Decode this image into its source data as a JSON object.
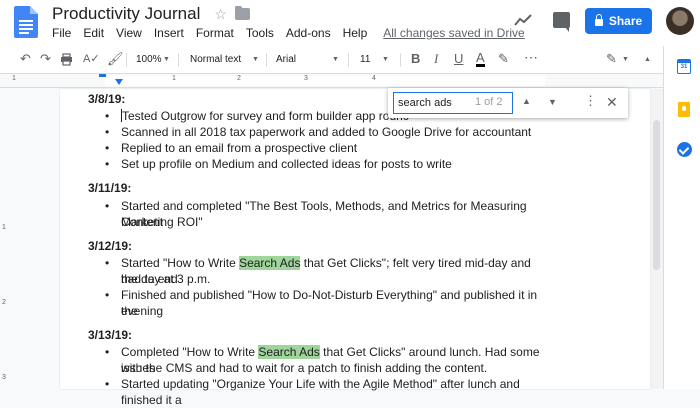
{
  "app": {
    "title": "Productivity Journal"
  },
  "menu": [
    {
      "label": "File"
    },
    {
      "label": "Edit"
    },
    {
      "label": "View"
    },
    {
      "label": "Insert"
    },
    {
      "label": "Format"
    },
    {
      "label": "Tools"
    },
    {
      "label": "Add-ons"
    },
    {
      "label": "Help"
    }
  ],
  "save_status": "All changes saved in Drive",
  "share": {
    "label": "Share"
  },
  "toolbar": {
    "zoom": "100%",
    "style": "Normal text",
    "font": "Arial",
    "font_size": "11"
  },
  "ruler": {
    "numbers": [
      "1",
      "1",
      "2",
      "3",
      "4"
    ]
  },
  "left_ruler": {
    "numbers": [
      "1",
      "2",
      "3"
    ]
  },
  "find": {
    "query": "search ads",
    "count": "1 of 2"
  },
  "side_panel": {
    "calendar_label": "31"
  },
  "document": {
    "entries": [
      {
        "date": "3/8/19:",
        "items": [
          "Tested Outgrow for survey and form builder app rounc",
          "Scanned in all 2018 tax paperwork and added to Google Drive for accountant",
          "Replied to an email from a prospective client",
          "Set up profile on Medium and collected ideas for posts to write"
        ]
      },
      {
        "date": "3/11/19:",
        "items": [
          "Started and completed \"The Best Tools, Methods, and Metrics for Measuring Content",
          "Marketing ROI\""
        ]
      },
      {
        "date": "3/12/19:",
        "items": [
          "Started \"How to Write ",
          "Search Ads",
          " that Get Clicks\"; felt very tired mid-day and had to end",
          "the day at 3 p.m.",
          "Finished and published \"How to Do-Not-Disturb Everything\" and published it in the",
          "evening"
        ]
      },
      {
        "date": "3/13/19:",
        "items": [
          "Completed \"How to Write ",
          "Search Ads",
          " that Get Clicks\" around lunch. Had some issues",
          "with the CMS and had to wait for a patch to finish adding the content.",
          "Started updating \"Organize Your Life with the Agile Method\" after lunch and finished it a"
        ]
      }
    ]
  }
}
